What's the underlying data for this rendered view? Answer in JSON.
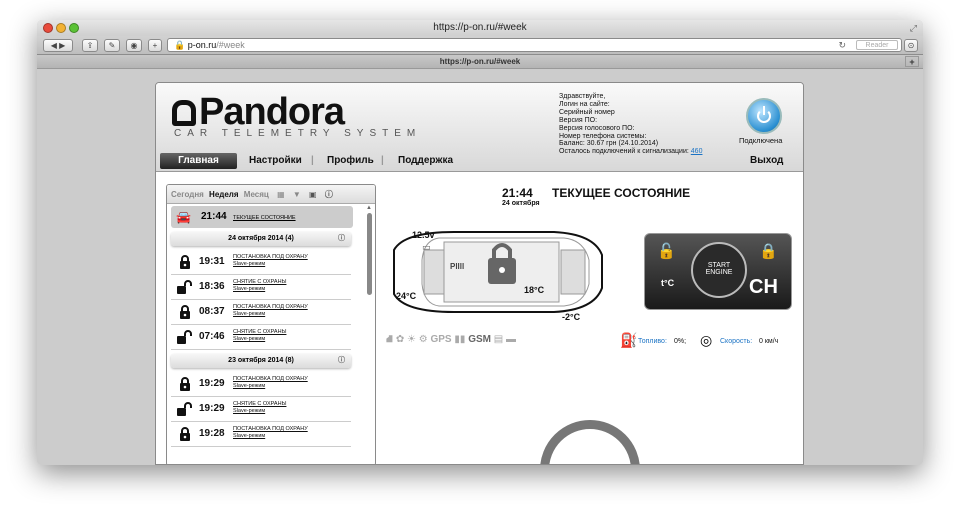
{
  "browser": {
    "window_title": "https://p-on.ru/#week",
    "url_host": "p-on.ru",
    "url_path": "/#week",
    "tab_title": "https://p-on.ru/#week",
    "reader_label": "Reader"
  },
  "brand": {
    "name": "Pandora",
    "tagline": "CAR TELEMETRY SYSTEM"
  },
  "account": {
    "greeting": "Здравствуйте,",
    "login": "Логин на сайте:",
    "serial": "Серийный номер",
    "fw": "Версия ПО:",
    "voice_fw": "Версия голосового ПО:",
    "phone": "Номер телефона системы:",
    "balance": "Баланс: 30.67 грн (24.10.2014)",
    "left_prefix": "Осталось подключений к сигнализации:",
    "left_count": "460"
  },
  "connection": {
    "status": "Подключена"
  },
  "nav": {
    "home": "Главная",
    "settings": "Настройки",
    "profile": "Профиль",
    "support": "Поддержка",
    "logout": "Выход"
  },
  "log": {
    "tabs": [
      "Сегодня",
      "Неделя",
      "Месяц"
    ],
    "current": {
      "time": "21:44",
      "label": "ТЕКУЩЕЕ СОСТОЯНИЕ"
    },
    "days": [
      {
        "title": "24 октября 2014  (4)",
        "events": [
          {
            "time": "19:31",
            "action": "ПОСТАНОВКА ПОД ОХРАНУ",
            "mode": "Slave-режим",
            "lock": "closed"
          },
          {
            "time": "18:36",
            "action": "СНЯТИЕ С ОХРАНЫ",
            "mode": "Slave-режим",
            "lock": "open"
          },
          {
            "time": "08:37",
            "action": "ПОСТАНОВКА ПОД ОХРАНУ",
            "mode": "Slave-режим",
            "lock": "closed"
          },
          {
            "time": "07:46",
            "action": "СНЯТИЕ С ОХРАНЫ",
            "mode": "Slave-режим",
            "lock": "open"
          }
        ]
      },
      {
        "title": "23 октября 2014  (8)",
        "events": [
          {
            "time": "19:29",
            "action": "ПОСТАНОВКА ПОД ОХРАНУ",
            "mode": "Slave-режим",
            "lock": "closed"
          },
          {
            "time": "19:29",
            "action": "СНЯТИЕ С ОХРАНЫ",
            "mode": "Slave-режим",
            "lock": "open"
          },
          {
            "time": "19:28",
            "action": "ПОСТАНОВКА ПОД ОХРАНУ",
            "mode": "Slave-режим",
            "lock": "closed"
          }
        ]
      }
    ]
  },
  "status": {
    "time": "21:44",
    "title": "ТЕКУЩЕЕ СОСТОЯНИЕ",
    "date": "24 октября",
    "voltage": "12.5v",
    "cabin_temp": "24°C",
    "engine_temp": "18°C",
    "outside_temp": "-2°C",
    "fuel_label": "Топливо:",
    "fuel_value": "0%;",
    "speed_label": "Скорость:",
    "speed_value": "0 км/ч",
    "gps": "GPS",
    "gsm": "GSM"
  },
  "control": {
    "start": "START",
    "engine": "ENGINE",
    "mode": "CH",
    "tc": "t°C"
  }
}
